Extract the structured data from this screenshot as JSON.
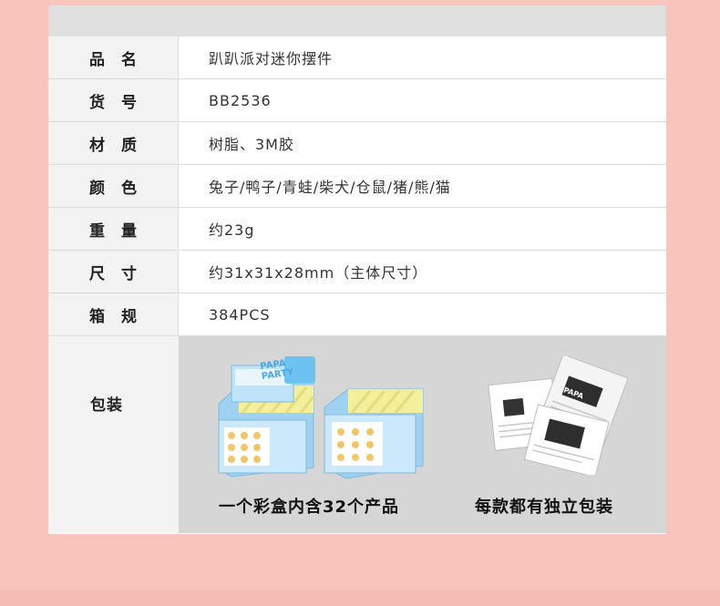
{
  "specs": [
    {
      "label": "品 名",
      "value": "趴趴派对迷你摆件"
    },
    {
      "label": "货 号",
      "value": "BB2536"
    },
    {
      "label": "材 质",
      "value": "树脂、3M胶"
    },
    {
      "label": "颜 色",
      "value": "兔子/鸭子/青蛙/柴犬/仓鼠/猪/熊/猫"
    },
    {
      "label": "重 量",
      "value": "约23g"
    },
    {
      "label": "尺 寸",
      "value": "约31x31x28mm（主体尺寸）"
    },
    {
      "label": "箱 规",
      "value": "384PCS"
    }
  ],
  "packaging": {
    "label": "包装",
    "box_caption": "一个彩盒内含32个产品",
    "pouch_caption": "每款都有独立包装",
    "box_brand": "PAPA PARTY",
    "pouch_brand": "PAPA"
  },
  "colors": {
    "background": "#f9c4bc",
    "header": "#e0e0e0",
    "label_bg": "#f3f3f3",
    "pack_bg": "#d6d6d6",
    "box_blue": "#9fd2f2",
    "box_yellow": "#f4ef9c"
  }
}
